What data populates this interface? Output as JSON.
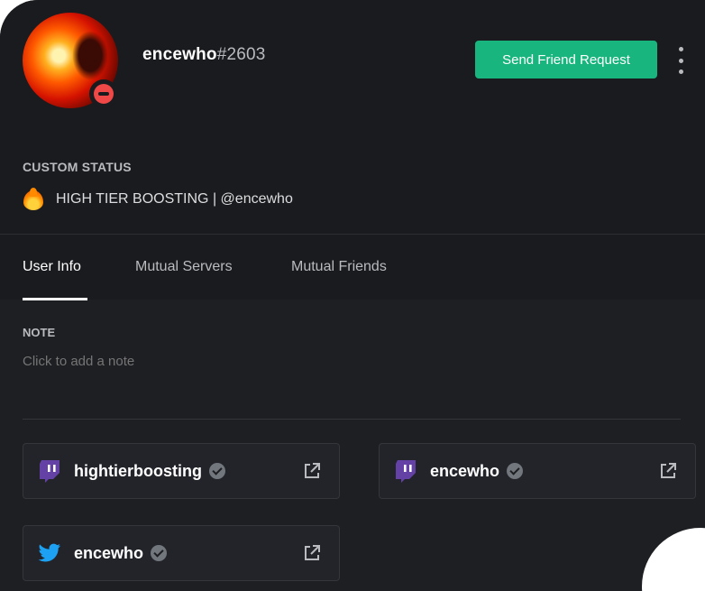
{
  "profile": {
    "username": "encewho",
    "discriminator": "#2603",
    "status": "dnd",
    "friend_button_label": "Send Friend Request"
  },
  "custom_status": {
    "title": "CUSTOM STATUS",
    "emoji": "fire-icon",
    "text": "HIGH TIER BOOSTING | @encewho"
  },
  "tabs": [
    {
      "label": "User Info",
      "active": true
    },
    {
      "label": "Mutual Servers",
      "active": false
    },
    {
      "label": "Mutual Friends",
      "active": false
    }
  ],
  "note": {
    "title": "NOTE",
    "placeholder": "Click to add a note"
  },
  "connections": [
    {
      "service": "twitch-icon",
      "name": "hightierboosting",
      "verified": true
    },
    {
      "service": "twitch-icon",
      "name": "encewho",
      "verified": true
    },
    {
      "service": "twitter-icon",
      "name": "encewho",
      "verified": true
    }
  ],
  "colors": {
    "accent_green": "#18b67e",
    "dnd_red": "#f04747",
    "twitch_purple": "#6441a5",
    "twitter_blue": "#1da1f2"
  }
}
